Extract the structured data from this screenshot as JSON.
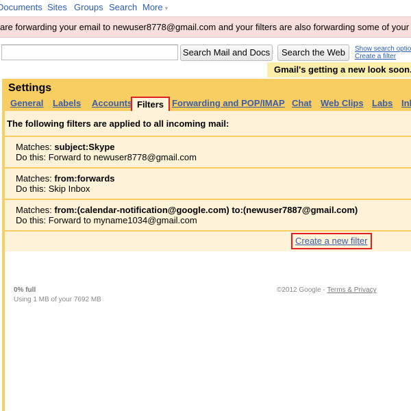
{
  "topnav": {
    "items": [
      "Documents",
      "Sites",
      "Groups",
      "Search",
      "More"
    ],
    "more_caret": "▾"
  },
  "banner": {
    "text": "are forwarding your email to newuser8778@gmail.com and your filters are also forwarding some of your email. T"
  },
  "search": {
    "input_value": "",
    "search_mail_label": "Search Mail and Docs",
    "search_web_label": "Search the Web",
    "show_options_link": "Show search options",
    "create_filter_link": "Create a filter"
  },
  "notice": {
    "text": "Gmail's getting a new look soon."
  },
  "settings": {
    "title": "Settings",
    "tabs": [
      "General",
      "Labels",
      "Accounts",
      "Filters",
      "Forwarding and POP/IMAP",
      "Chat",
      "Web Clips",
      "Labs",
      "Inbox"
    ],
    "active_tab": "Filters",
    "intro": "The following filters are applied to all incoming mail:",
    "filters": [
      {
        "matches_label": "Matches:",
        "matches": "subject:Skype",
        "action_label": "Do this:",
        "action": "Forward to newuser8778@gmail.com"
      },
      {
        "matches_label": "Matches:",
        "matches": "from:forwards",
        "action_label": "Do this:",
        "action": "Skip Inbox"
      },
      {
        "matches_label": "Matches:",
        "matches": "from:(calendar-notification@google.com) to:(newuser7887@gmail.com)",
        "action_label": "Do this:",
        "action": "Forward to myname1034@gmail.com"
      }
    ],
    "create_new_filter": "Create a new filter"
  },
  "quota": {
    "percent": "0% full",
    "usage": "Using 1 MB of your 7692 MB"
  },
  "footer": {
    "copyright": "©2012 Google - ",
    "terms_link": "Terms & Privacy"
  },
  "colors": {
    "settings_header": "#f8cd62",
    "content_bg": "#fef3d8",
    "banner_bg": "#f9dede",
    "link": "#2a5db0",
    "highlight_box": "#e02020"
  }
}
